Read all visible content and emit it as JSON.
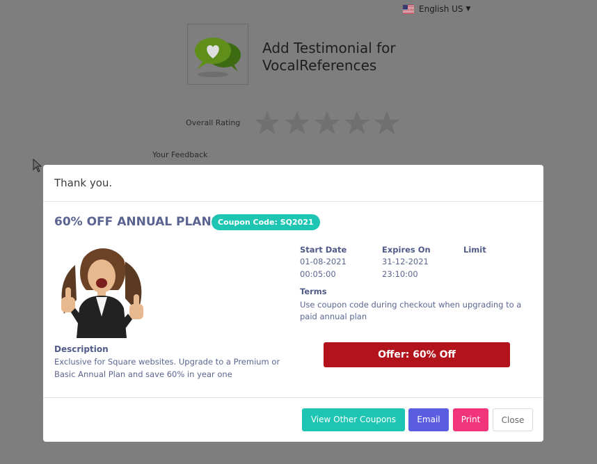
{
  "language": {
    "label": "English US",
    "flag_icon": "us-flag-icon"
  },
  "background_page": {
    "title_line1": "Add Testimonial for",
    "title_line2": "VocalReferences",
    "overall_rating_label": "Overall Rating",
    "star_count": 5,
    "your_feedback_label": "Your Feedback"
  },
  "modal": {
    "header": "Thank you.",
    "offer_title": "60% OFF ANNUAL PLANS",
    "coupon_badge": "Coupon Code: SQ2021",
    "start_date_label": "Start Date",
    "start_date": "01-08-2021",
    "start_time": "00:05:00",
    "expires_label": "Expires On",
    "expires_date": "31-12-2021",
    "expires_time": "23:10:00",
    "limit_label": "Limit",
    "terms_label": "Terms",
    "terms_text": "Use coupon code during checkout when upgrading to a paid annual plan",
    "description_label": "Description",
    "description_text": "Exclusive for Square websites. Upgrade to a Premium or Basic Annual Plan and save 60% in year one",
    "offer_button": "Offer: 60% Off",
    "buttons": {
      "view_other": "View Other Coupons",
      "email": "Email",
      "print": "Print",
      "close": "Close"
    }
  },
  "colors": {
    "teal": "#1ec5b2",
    "offer_red": "#b3131a",
    "email_blue": "#5a5de0",
    "print_pink": "#f2357a",
    "heading_navy": "#5a6491"
  }
}
